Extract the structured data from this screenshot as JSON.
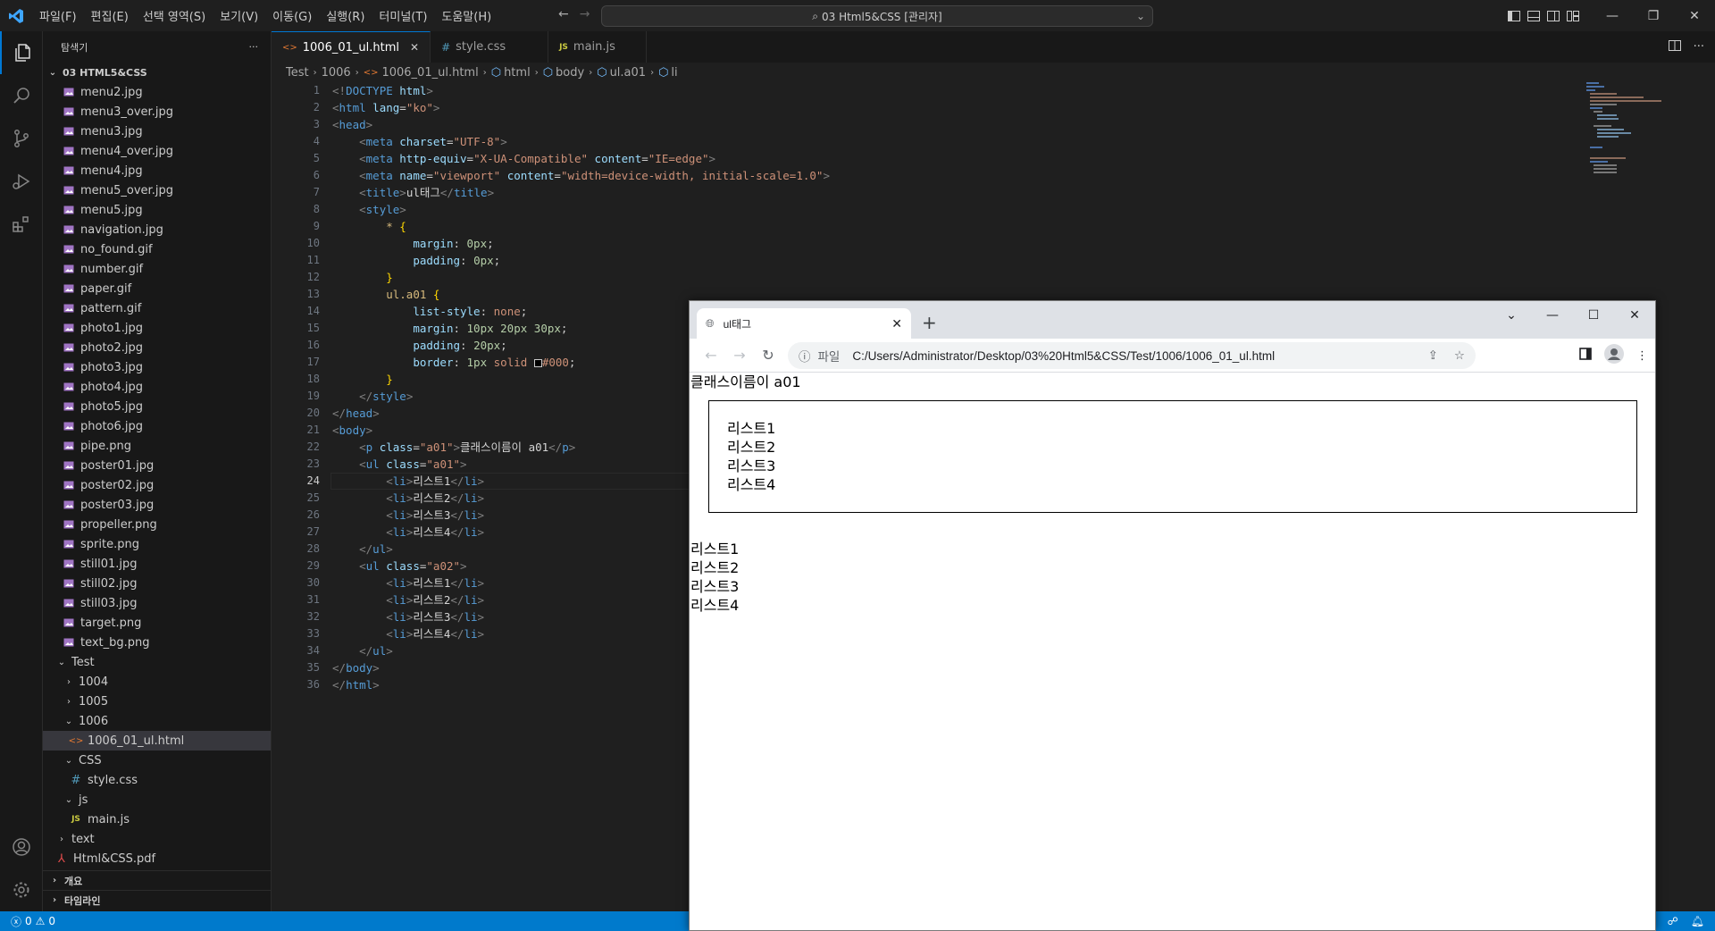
{
  "titlebar": {
    "menu": [
      "파일(F)",
      "편집(E)",
      "선택 영역(S)",
      "보기(V)",
      "이동(G)",
      "실행(R)",
      "터미널(T)",
      "도움말(H)"
    ],
    "command_center": "03 Html5&CSS [관리자]"
  },
  "sidebar": {
    "title": "탐색기",
    "folder": "03 HTML5&CSS",
    "files": [
      "menu2.jpg",
      "menu3_over.jpg",
      "menu3.jpg",
      "menu4_over.jpg",
      "menu4.jpg",
      "menu5_over.jpg",
      "menu5.jpg",
      "navigation.jpg",
      "no_found.gif",
      "number.gif",
      "paper.gif",
      "pattern.gif",
      "photo1.jpg",
      "photo2.jpg",
      "photo3.jpg",
      "photo4.jpg",
      "photo5.jpg",
      "photo6.jpg",
      "pipe.png",
      "poster01.jpg",
      "poster02.jpg",
      "poster03.jpg",
      "propeller.png",
      "sprite.png",
      "still01.jpg",
      "still02.jpg",
      "still03.jpg",
      "target.png",
      "text_bg.png"
    ],
    "test_folder": "Test",
    "sub_1004": "1004",
    "sub_1005": "1005",
    "sub_1006": "1006",
    "active_file": "1006_01_ul.html",
    "css_folder": "CSS",
    "css_file": "style.css",
    "js_folder": "js",
    "js_file": "main.js",
    "text_folder": "text",
    "pdf_file": "Html&CSS.pdf",
    "outline": "개요",
    "timeline": "타임라인"
  },
  "tabs": [
    {
      "label": "1006_01_ul.html",
      "icon": "<>"
    },
    {
      "label": "style.css",
      "icon": "#"
    },
    {
      "label": "main.js",
      "icon": "JS"
    }
  ],
  "breadcrumb": [
    "Test",
    "1006",
    "1006_01_ul.html",
    "html",
    "body",
    "ul.a01",
    "li"
  ],
  "editor": {
    "current_line": "24",
    "line_numbers": [
      "1",
      "2",
      "3",
      "4",
      "5",
      "6",
      "7",
      "8",
      "9",
      "10",
      "11",
      "12",
      "13",
      "14",
      "15",
      "16",
      "17",
      "18",
      "19",
      "20",
      "21",
      "22",
      "23",
      "24",
      "25",
      "26",
      "27",
      "28",
      "29",
      "30",
      "31",
      "32",
      "33",
      "34",
      "35",
      "36"
    ]
  },
  "status": {
    "errors": "0",
    "warnings": "0"
  },
  "browser": {
    "tab_title": "ul태그",
    "address_label": "파일",
    "url": "C:/Users/Administrator/Desktop/03%20Html5&CSS/Test/1006/1006_01_ul.html",
    "paragraph": "클래스이름이 a01",
    "list_a01": [
      "리스트1",
      "리스트2",
      "리스트3",
      "리스트4"
    ],
    "list_a02": [
      "리스트1",
      "리스트2",
      "리스트3",
      "리스트4"
    ]
  }
}
